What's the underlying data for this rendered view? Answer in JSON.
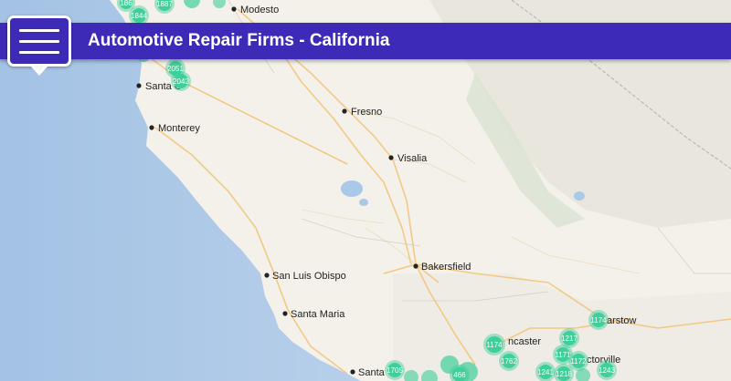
{
  "header": {
    "title": "Automotive Repair Firms - California"
  },
  "map": {
    "cities": [
      {
        "id": "modesto",
        "label": "Modesto"
      },
      {
        "id": "santa-cruz",
        "label": "Santa C"
      },
      {
        "id": "monterey",
        "label": "Monterey"
      },
      {
        "id": "fresno",
        "label": "Fresno"
      },
      {
        "id": "visalia",
        "label": "Visalia"
      },
      {
        "id": "bakersfield",
        "label": "Bakersfield"
      },
      {
        "id": "san-luis-obispo",
        "label": "San Luis Obispo"
      },
      {
        "id": "santa-maria",
        "label": "Santa Maria"
      },
      {
        "id": "lancaster",
        "label": "ncaster"
      },
      {
        "id": "barstow",
        "label": "arstow"
      },
      {
        "id": "victorville",
        "label": "ctorville"
      },
      {
        "id": "santa-clarita",
        "label": "Santa"
      }
    ],
    "clusters": [
      {
        "id": "c1",
        "label": "1887"
      },
      {
        "id": "c2",
        "label": "1844"
      },
      {
        "id": "c3",
        "label": "186"
      },
      {
        "id": "c4",
        "label": "2051"
      },
      {
        "id": "c5",
        "label": "2042"
      },
      {
        "id": "c6",
        "label": "1174"
      },
      {
        "id": "c7",
        "label": "1217"
      },
      {
        "id": "c8",
        "label": "1174"
      },
      {
        "id": "c9",
        "label": "1762"
      },
      {
        "id": "c10",
        "label": "1171"
      },
      {
        "id": "c11",
        "label": "1172"
      },
      {
        "id": "c12",
        "label": "1243"
      },
      {
        "id": "c13",
        "label": "1218"
      },
      {
        "id": "c14",
        "label": "1241"
      },
      {
        "id": "c15",
        "label": "466"
      },
      {
        "id": "c16",
        "label": "1705"
      }
    ],
    "colors": {
      "ocean": "#a8c4e3",
      "land": "#f4f1ea",
      "header": "#3d2bb8",
      "cluster": "#3fcf9a"
    }
  }
}
